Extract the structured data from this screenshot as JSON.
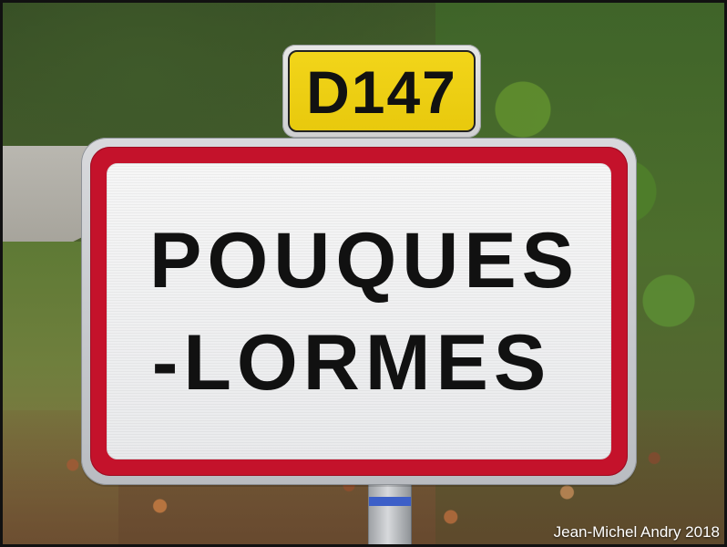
{
  "photo": {
    "route_plate": "D147",
    "town_name_line1": "POUQUES",
    "town_name_line2": "-LORMES",
    "credit": "Jean-Michel Andry 2018"
  },
  "colors": {
    "sign_red": "#c4122b",
    "sign_white": "#f3f3f3",
    "plate_yellow": "#f2d51a",
    "text_black": "#111111"
  }
}
